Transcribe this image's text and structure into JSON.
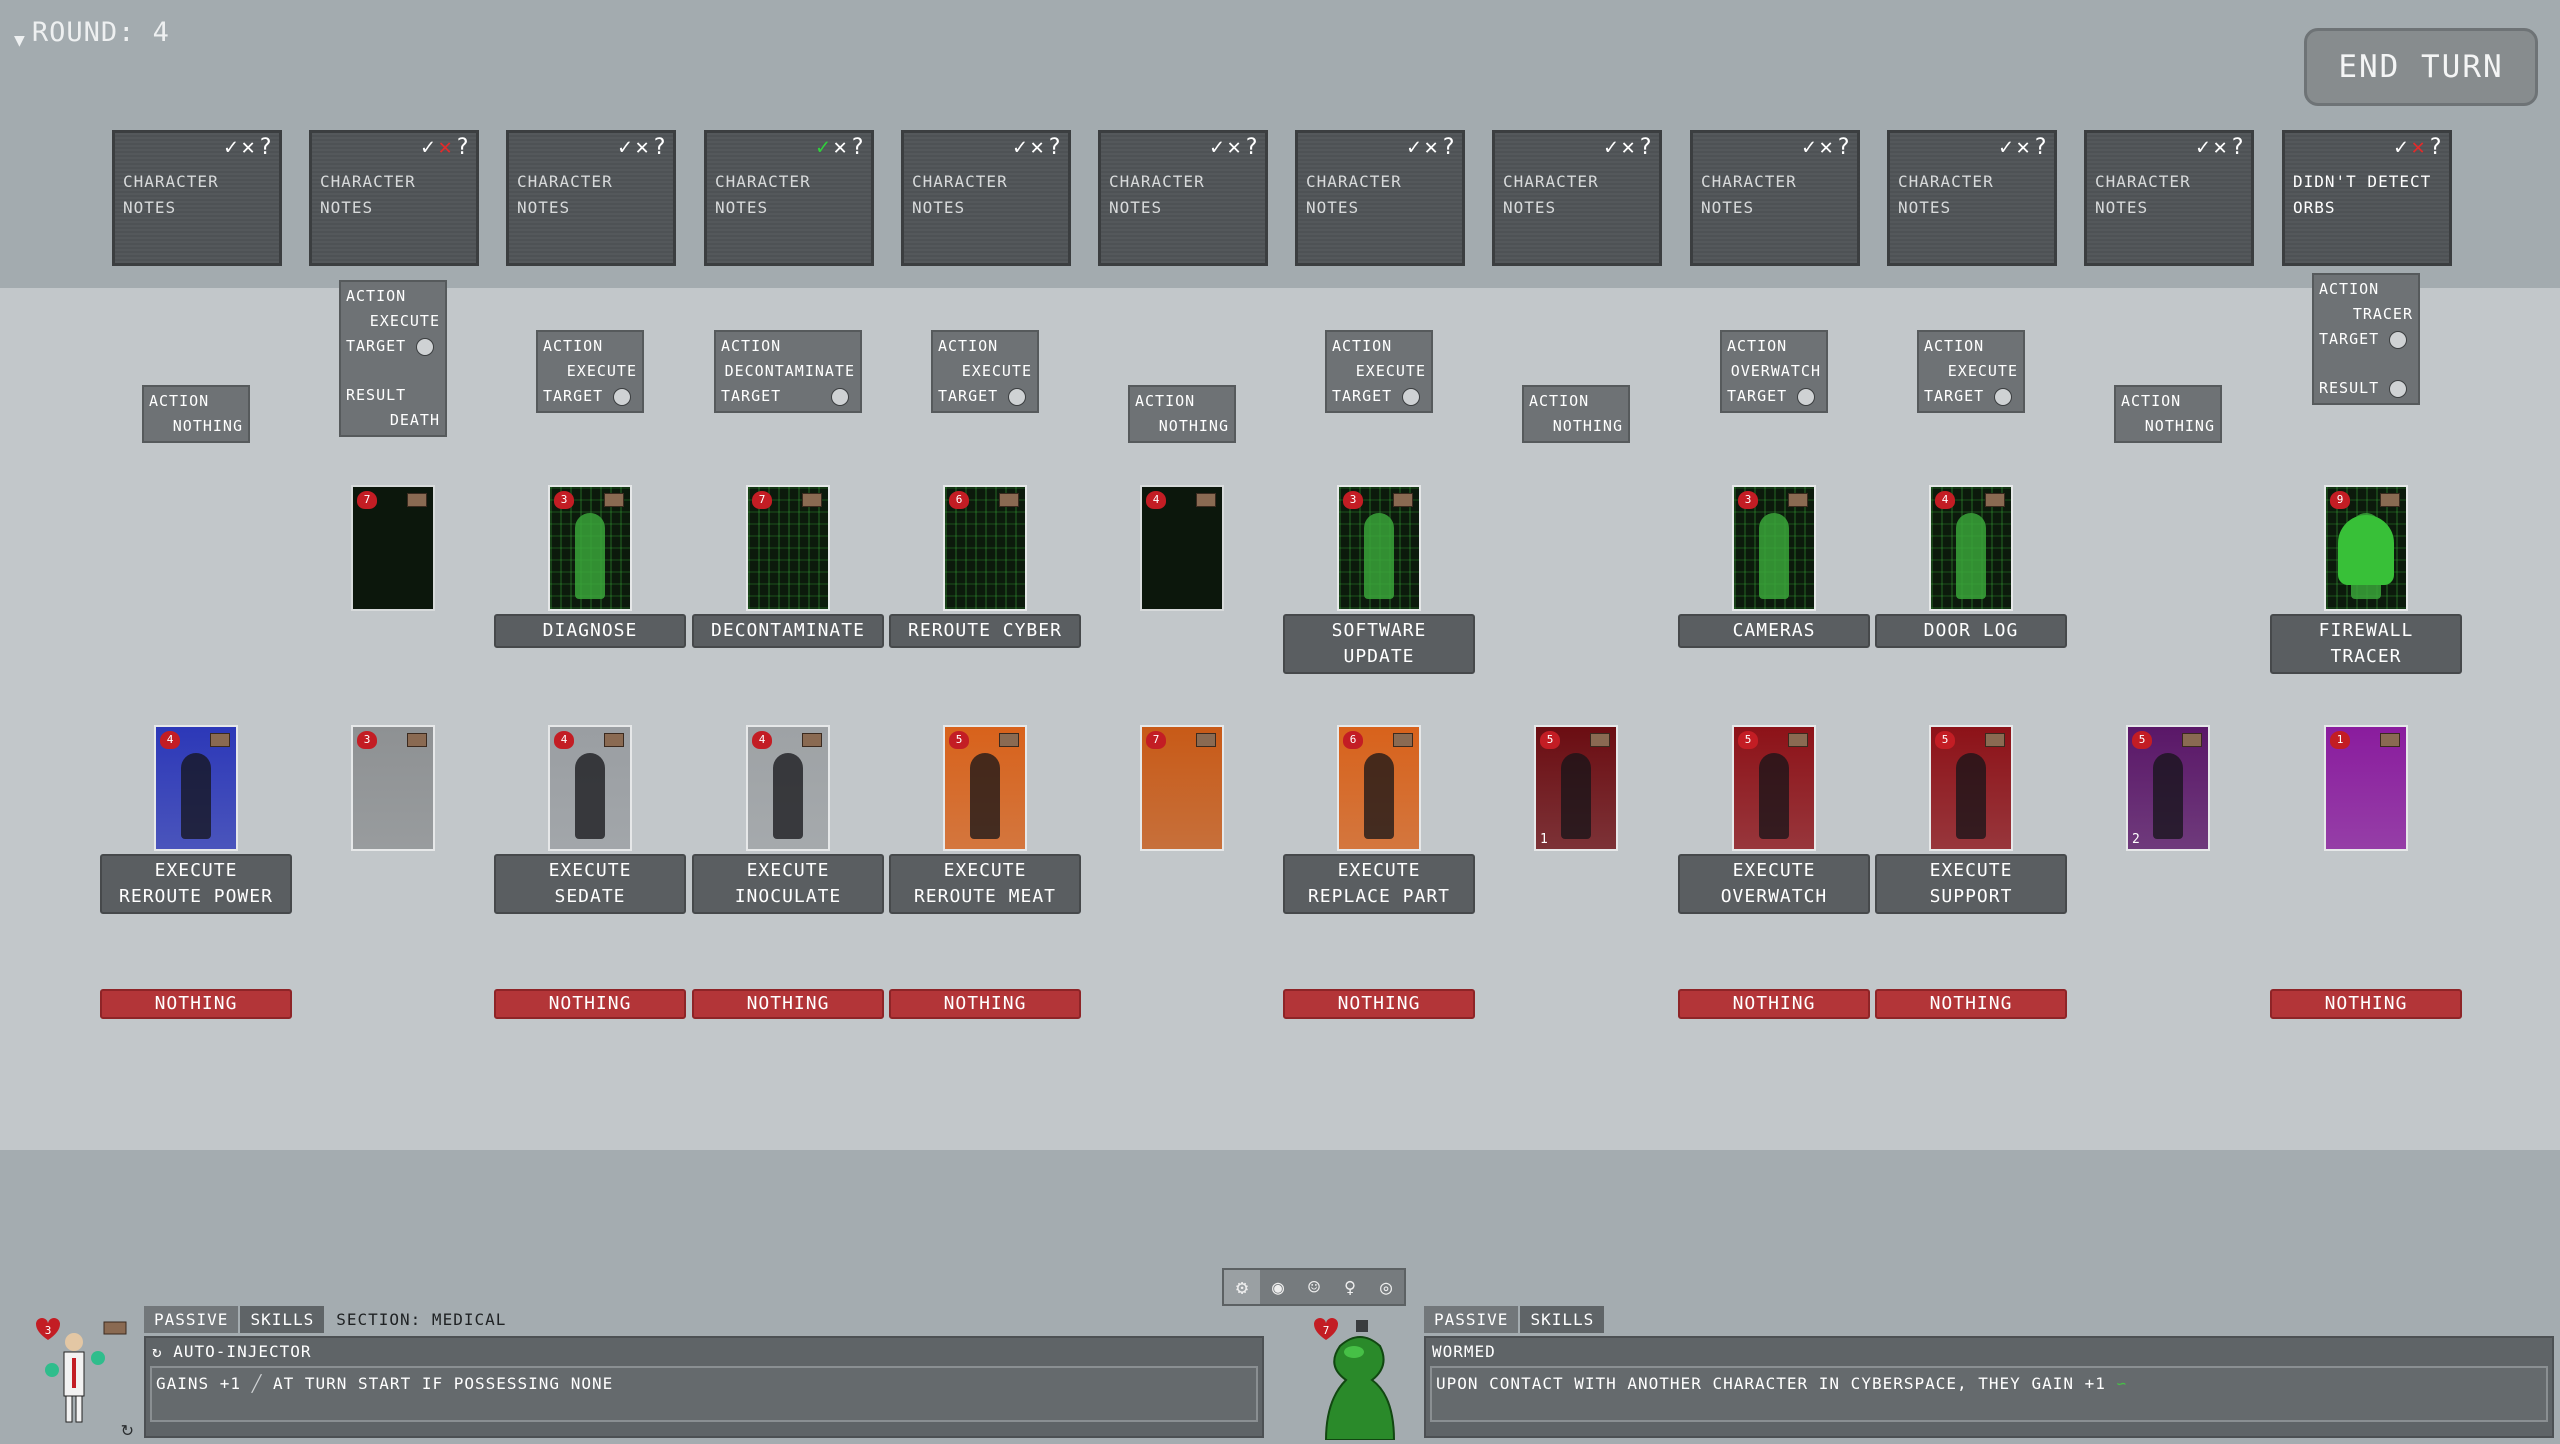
{
  "round": {
    "label": "ROUND: 4"
  },
  "end_turn": {
    "label": "END TURN"
  },
  "notes": [
    {
      "text": "CHARACTER NOTES",
      "check": false,
      "x": false
    },
    {
      "text": "CHARACTER NOTES",
      "check": false,
      "x": true
    },
    {
      "text": "CHARACTER NOTES",
      "check": false,
      "x": false
    },
    {
      "text": "CHARACTER NOTES",
      "check": true,
      "x": false
    },
    {
      "text": "CHARACTER NOTES",
      "check": false,
      "x": false
    },
    {
      "text": "CHARACTER NOTES",
      "check": false,
      "x": false
    },
    {
      "text": "CHARACTER NOTES",
      "check": false,
      "x": false
    },
    {
      "text": "CHARACTER NOTES",
      "check": false,
      "x": false
    },
    {
      "text": "CHARACTER NOTES",
      "check": false,
      "x": false
    },
    {
      "text": "CHARACTER NOTES",
      "check": false,
      "x": false
    },
    {
      "text": "CHARACTER NOTES",
      "check": false,
      "x": false
    },
    {
      "text": "DIDN'T DETECT ORBS",
      "check": false,
      "x": true
    }
  ],
  "note_marks": {
    "check": "✓",
    "x": "✕",
    "q": "?"
  },
  "actions": [
    {
      "action_label": "ACTION",
      "action": "NOTHING"
    },
    {
      "action_label": "ACTION",
      "action": "EXECUTE",
      "target_label": "TARGET",
      "result_label": "RESULT",
      "result": "DEATH"
    },
    {
      "action_label": "ACTION",
      "action": "EXECUTE",
      "target_label": "TARGET"
    },
    {
      "action_label": "ACTION",
      "action": "DECONTAMINATE",
      "target_label": "TARGET"
    },
    {
      "action_label": "ACTION",
      "action": "EXECUTE",
      "target_label": "TARGET"
    },
    {
      "action_label": "ACTION",
      "action": "NOTHING"
    },
    {
      "action_label": "ACTION",
      "action": "EXECUTE",
      "target_label": "TARGET"
    },
    {
      "action_label": "ACTION",
      "action": "NOTHING"
    },
    {
      "action_label": "ACTION",
      "action": "OVERWATCH",
      "target_label": "TARGET"
    },
    {
      "action_label": "ACTION",
      "action": "EXECUTE",
      "target_label": "TARGET"
    },
    {
      "action_label": "ACTION",
      "action": "NOTHING"
    },
    {
      "action_label": "ACTION",
      "action": "TRACER",
      "target_label": "TARGET",
      "result_label": "RESULT"
    }
  ],
  "cyber_cards": [
    null,
    {
      "hp": "7",
      "label": ""
    },
    {
      "hp": "3",
      "label": "DIAGNOSE"
    },
    {
      "hp": "7",
      "label": "DECONTAMINATE"
    },
    {
      "hp": "6",
      "label": "REROUTE CYBER"
    },
    {
      "hp": "4",
      "label": ""
    },
    {
      "hp": "3",
      "label": "SOFTWARE UPDATE"
    },
    null,
    {
      "hp": "3",
      "label": "CAMERAS"
    },
    {
      "hp": "4",
      "label": "DOOR LOG"
    },
    null,
    {
      "hp": "9",
      "label": "FIREWALL TRACER"
    }
  ],
  "char_cards": [
    {
      "hp": "4",
      "label": "EXECUTE REROUTE POWER",
      "result": "NOTHING",
      "color": "#2c38b8"
    },
    {
      "hp": "3",
      "label": "",
      "result": "",
      "color": "#8e9193"
    },
    {
      "hp": "4",
      "label": "EXECUTE SEDATE",
      "result": "NOTHING",
      "color": "#9a9ea2"
    },
    {
      "hp": "4",
      "label": "EXECUTE INOCULATE",
      "result": "NOTHING",
      "color": "#9ea2a5"
    },
    {
      "hp": "5",
      "label": "EXECUTE REROUTE MEAT",
      "result": "NOTHING",
      "color": "#d8621b"
    },
    {
      "hp": "7",
      "label": "",
      "result": "",
      "color": "#c85a17"
    },
    {
      "hp": "6",
      "label": "EXECUTE REPLACE PART",
      "result": "NOTHING",
      "color": "#d8621b"
    },
    {
      "hp": "5",
      "label": "",
      "result": "",
      "color": "#6b0d12",
      "num": "1"
    },
    {
      "hp": "5",
      "label": "EXECUTE OVERWATCH",
      "result": "NOTHING",
      "color": "#8d1218"
    },
    {
      "hp": "5",
      "label": "EXECUTE SUPPORT",
      "result": "NOTHING",
      "color": "#8d1218"
    },
    {
      "hp": "5",
      "label": "",
      "result": "",
      "color": "#5a1768",
      "num": "2"
    },
    {
      "hp": "1",
      "label": "",
      "result": "NOTHING",
      "color": "#8a1c9e"
    }
  ],
  "bottom_icons": [
    "⚙",
    "◉",
    "☺",
    "♀",
    "◎"
  ],
  "left_panel": {
    "hp": "3",
    "tabs": {
      "passive": "PASSIVE",
      "skills": "SKILLS",
      "section": "SECTION: MEDICAL"
    },
    "skill_name": "AUTO-INJECTOR",
    "skill_desc_a": "GAINS +1",
    "skill_desc_b": "AT TURN START IF POSSESSING NONE"
  },
  "right_panel": {
    "hp": "7",
    "tabs": {
      "passive": "PASSIVE",
      "skills": "SKILLS"
    },
    "skill_name": "WORMED",
    "skill_desc": "UPON CONTACT WITH ANOTHER CHARACTER IN CYBERSPACE, THEY GAIN +1"
  }
}
